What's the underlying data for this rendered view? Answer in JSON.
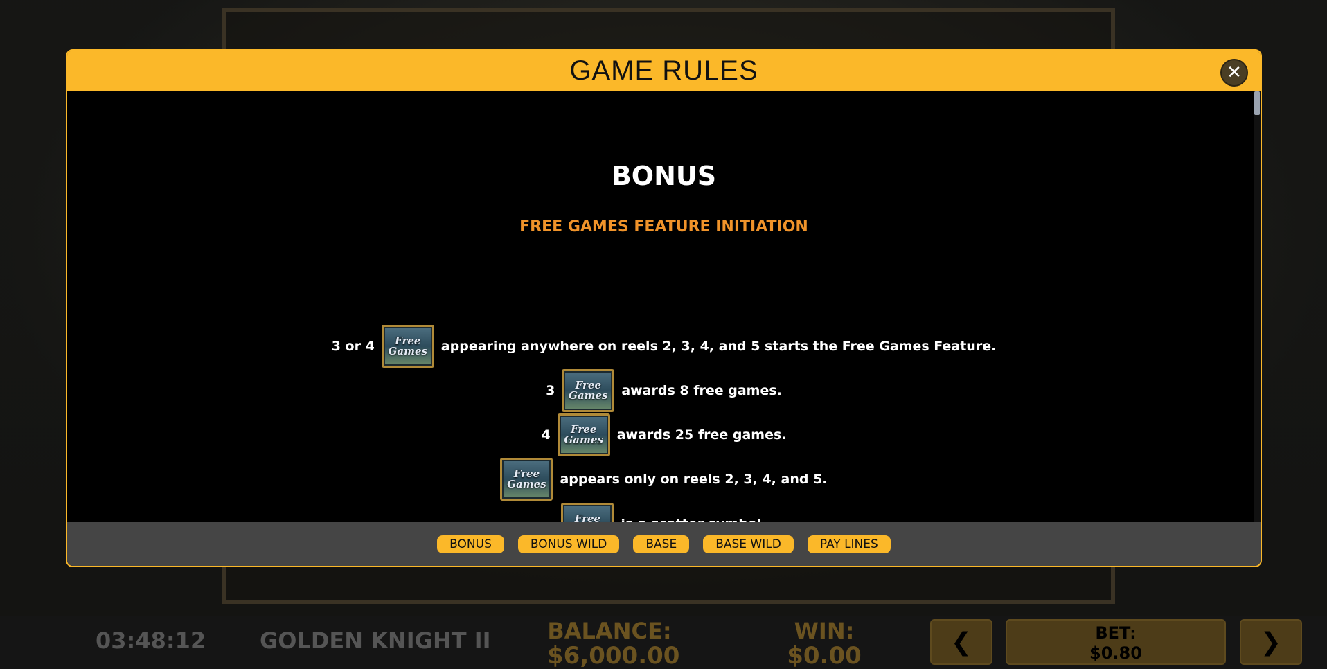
{
  "modal": {
    "title": "GAME RULES",
    "close_label": "✕",
    "section_title": "BONUS",
    "section_subtitle": "FREE GAMES FEATURE INITIATION",
    "symbol_text": "Free Games",
    "rules": [
      {
        "prefix": "3 or 4",
        "text": "appearing anywhere on reels 2, 3, 4, and 5 starts the Free Games Feature."
      },
      {
        "prefix": "3",
        "text": "awards 8 free games."
      },
      {
        "prefix": "4",
        "text": "awards 25 free games."
      },
      {
        "prefix": "",
        "text": "appears only on reels 2, 3, 4, and 5."
      },
      {
        "prefix": "",
        "text": "is a scatter symbol."
      }
    ],
    "tabs": [
      "BONUS",
      "BONUS WILD",
      "BASE",
      "BASE WILD",
      "PAY LINES"
    ]
  },
  "bottombar": {
    "clock": "03:48:12",
    "game_name": "GOLDEN KNIGHT II",
    "balance_label": "BALANCE:",
    "balance_value": "$6,000.00",
    "win_label": "WIN:",
    "win_value": "$0.00",
    "bet_label": "BET:",
    "bet_value": "$0.80",
    "prev_label": "❮",
    "next_label": "❯"
  },
  "colors": {
    "accent": "#fbb829",
    "subtitle": "#f0932a",
    "footer_bg": "#454545"
  }
}
